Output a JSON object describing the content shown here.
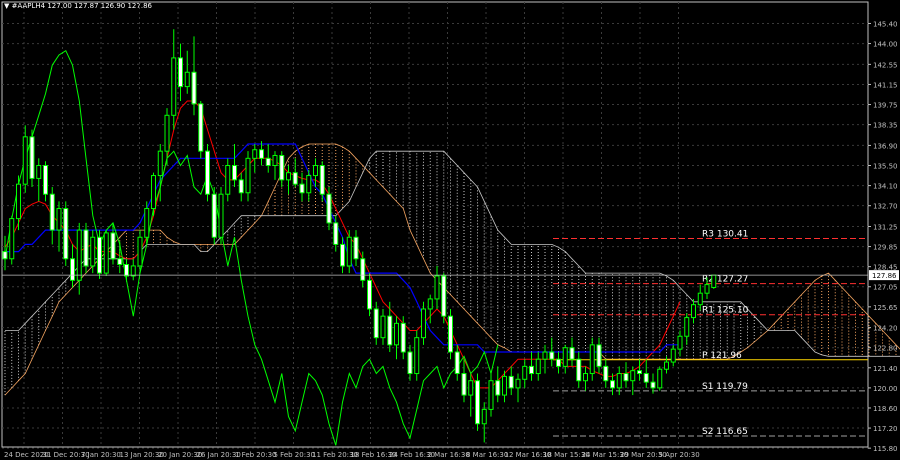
{
  "header": {
    "symbol_line": "#AAPLH4 127.00 127.87 126.90 127.86"
  },
  "colors": {
    "background": "#000000",
    "grid": "#3a3a3a",
    "axis": "#c0c0c0",
    "bull_candle": "#00ff00",
    "bull_body": "#000000",
    "bear_candle": "#00ff00",
    "bear_body": "#ffffff",
    "tenkan": "#ff0000",
    "kijun": "#0000ff",
    "chikou": "#00ff00",
    "kumo_bull": "#f4a460",
    "kumo_bear": "#c8c8c8",
    "pivot_main": "#ffd700",
    "pivot_res": "#ff3030",
    "pivot_sup": "#a0a0a0",
    "price_line": "#c0c0c0"
  },
  "chart_data": {
    "type": "candlestick",
    "grid": true,
    "y_range": [
      115.88,
      146.2
    ],
    "y_ticks": [
      "145.40",
      "144.00",
      "142.55",
      "141.15",
      "139.75",
      "138.35",
      "136.90",
      "135.50",
      "134.10",
      "132.70",
      "131.25",
      "129.85",
      "128.45",
      "127.05",
      "125.65",
      "124.20",
      "122.80",
      "121.40",
      "120.00",
      "118.60",
      "117.20",
      "115.80"
    ],
    "x_labels": [
      "24 Dec 2020",
      "31 Dec 20:30",
      "7 Jan 20:30",
      "13 Jan 20:30",
      "20 Jan 20:30",
      "26 Jan 20:30",
      "1 Feb 20:30",
      "5 Feb 20:30",
      "11 Feb 20:30",
      "18 Feb 16:30",
      "24 Feb 16:30",
      "2 Mar 16:30",
      "8 Mar 16:30",
      "12 Mar 16:30",
      "18 Mar 15:30",
      "24 Mar 15:30",
      "29 Mar 20:30",
      "5 Apr 20:30"
    ],
    "current_price": "127.86",
    "candles": [
      {
        "o": 129.5,
        "h": 130.6,
        "l": 128.2,
        "c": 129.0
      },
      {
        "o": 129.0,
        "h": 132.0,
        "l": 128.6,
        "c": 131.8
      },
      {
        "o": 131.8,
        "h": 134.8,
        "l": 131.0,
        "c": 134.2
      },
      {
        "o": 134.2,
        "h": 138.3,
        "l": 133.6,
        "c": 137.5
      },
      {
        "o": 137.5,
        "h": 138.0,
        "l": 134.0,
        "c": 134.6
      },
      {
        "o": 134.6,
        "h": 136.0,
        "l": 133.0,
        "c": 135.5
      },
      {
        "o": 135.5,
        "h": 135.8,
        "l": 133.0,
        "c": 133.5
      },
      {
        "o": 133.5,
        "h": 134.0,
        "l": 130.0,
        "c": 131.0
      },
      {
        "o": 131.0,
        "h": 133.0,
        "l": 129.5,
        "c": 132.5
      },
      {
        "o": 132.5,
        "h": 133.0,
        "l": 128.5,
        "c": 129.0
      },
      {
        "o": 129.0,
        "h": 130.0,
        "l": 127.0,
        "c": 127.5
      },
      {
        "o": 127.5,
        "h": 131.5,
        "l": 126.5,
        "c": 131.0
      },
      {
        "o": 131.0,
        "h": 131.5,
        "l": 128.0,
        "c": 128.5
      },
      {
        "o": 128.5,
        "h": 131.0,
        "l": 128.0,
        "c": 130.5
      },
      {
        "o": 130.5,
        "h": 131.0,
        "l": 127.6,
        "c": 128.0
      },
      {
        "o": 128.0,
        "h": 131.0,
        "l": 127.8,
        "c": 130.8
      },
      {
        "o": 130.8,
        "h": 131.5,
        "l": 128.6,
        "c": 129.0
      },
      {
        "o": 129.0,
        "h": 130.2,
        "l": 128.0,
        "c": 128.6
      },
      {
        "o": 128.6,
        "h": 129.0,
        "l": 127.4,
        "c": 127.8
      },
      {
        "o": 127.8,
        "h": 129.0,
        "l": 127.5,
        "c": 128.5
      },
      {
        "o": 128.5,
        "h": 131.0,
        "l": 128.0,
        "c": 130.5
      },
      {
        "o": 130.5,
        "h": 133.0,
        "l": 130.0,
        "c": 132.5
      },
      {
        "o": 132.5,
        "h": 135.0,
        "l": 132.0,
        "c": 134.8
      },
      {
        "o": 134.8,
        "h": 137.0,
        "l": 133.0,
        "c": 136.5
      },
      {
        "o": 136.5,
        "h": 139.5,
        "l": 135.5,
        "c": 139.0
      },
      {
        "o": 139.0,
        "h": 145.0,
        "l": 138.0,
        "c": 143.0
      },
      {
        "o": 143.0,
        "h": 144.0,
        "l": 140.0,
        "c": 141.0
      },
      {
        "o": 141.0,
        "h": 143.5,
        "l": 140.5,
        "c": 142.0
      },
      {
        "o": 142.0,
        "h": 144.5,
        "l": 139.0,
        "c": 139.8
      },
      {
        "o": 139.8,
        "h": 140.0,
        "l": 136.0,
        "c": 136.5
      },
      {
        "o": 136.5,
        "h": 137.0,
        "l": 133.0,
        "c": 133.5
      },
      {
        "o": 133.5,
        "h": 134.0,
        "l": 130.0,
        "c": 130.5
      },
      {
        "o": 130.5,
        "h": 134.0,
        "l": 130.0,
        "c": 133.5
      },
      {
        "o": 133.5,
        "h": 136.0,
        "l": 133.0,
        "c": 135.5
      },
      {
        "o": 135.5,
        "h": 137.0,
        "l": 134.0,
        "c": 134.5
      },
      {
        "o": 134.5,
        "h": 135.0,
        "l": 133.0,
        "c": 133.6
      },
      {
        "o": 133.6,
        "h": 136.5,
        "l": 133.0,
        "c": 136.0
      },
      {
        "o": 136.0,
        "h": 137.0,
        "l": 135.0,
        "c": 136.6
      },
      {
        "o": 136.6,
        "h": 137.2,
        "l": 135.5,
        "c": 136.0
      },
      {
        "o": 136.0,
        "h": 137.0,
        "l": 135.0,
        "c": 135.5
      },
      {
        "o": 135.5,
        "h": 136.5,
        "l": 134.5,
        "c": 136.2
      },
      {
        "o": 136.2,
        "h": 136.5,
        "l": 134.0,
        "c": 134.5
      },
      {
        "o": 134.5,
        "h": 135.5,
        "l": 133.5,
        "c": 135.0
      },
      {
        "o": 135.0,
        "h": 136.0,
        "l": 134.0,
        "c": 134.2
      },
      {
        "o": 134.2,
        "h": 135.0,
        "l": 133.0,
        "c": 133.6
      },
      {
        "o": 133.6,
        "h": 135.2,
        "l": 133.0,
        "c": 134.8
      },
      {
        "o": 134.8,
        "h": 136.0,
        "l": 134.0,
        "c": 135.5
      },
      {
        "o": 135.5,
        "h": 135.8,
        "l": 133.0,
        "c": 133.5
      },
      {
        "o": 133.5,
        "h": 134.0,
        "l": 131.0,
        "c": 131.5
      },
      {
        "o": 131.5,
        "h": 132.0,
        "l": 129.5,
        "c": 130.0
      },
      {
        "o": 130.0,
        "h": 130.5,
        "l": 128.0,
        "c": 128.5
      },
      {
        "o": 128.5,
        "h": 131.0,
        "l": 128.0,
        "c": 130.5
      },
      {
        "o": 130.5,
        "h": 131.0,
        "l": 128.5,
        "c": 129.0
      },
      {
        "o": 129.0,
        "h": 129.5,
        "l": 127.0,
        "c": 127.5
      },
      {
        "o": 127.5,
        "h": 128.0,
        "l": 125.0,
        "c": 125.5
      },
      {
        "o": 125.5,
        "h": 126.0,
        "l": 123.0,
        "c": 123.5
      },
      {
        "o": 123.5,
        "h": 125.5,
        "l": 123.0,
        "c": 125.0
      },
      {
        "o": 125.0,
        "h": 126.0,
        "l": 122.5,
        "c": 123.0
      },
      {
        "o": 123.0,
        "h": 125.0,
        "l": 122.0,
        "c": 124.5
      },
      {
        "o": 124.5,
        "h": 125.0,
        "l": 122.0,
        "c": 122.5
      },
      {
        "o": 122.5,
        "h": 123.0,
        "l": 120.5,
        "c": 121.0
      },
      {
        "o": 121.0,
        "h": 124.0,
        "l": 120.5,
        "c": 123.5
      },
      {
        "o": 123.5,
        "h": 126.0,
        "l": 123.0,
        "c": 125.5
      },
      {
        "o": 125.5,
        "h": 126.5,
        "l": 124.5,
        "c": 126.2
      },
      {
        "o": 126.2,
        "h": 128.5,
        "l": 125.5,
        "c": 127.8
      },
      {
        "o": 127.8,
        "h": 128.0,
        "l": 124.5,
        "c": 125.0
      },
      {
        "o": 125.0,
        "h": 125.5,
        "l": 122.0,
        "c": 122.5
      },
      {
        "o": 122.5,
        "h": 123.0,
        "l": 120.5,
        "c": 121.0
      },
      {
        "o": 121.0,
        "h": 122.0,
        "l": 119.0,
        "c": 119.5
      },
      {
        "o": 119.5,
        "h": 121.0,
        "l": 118.0,
        "c": 120.5
      },
      {
        "o": 120.5,
        "h": 121.0,
        "l": 117.0,
        "c": 117.5
      },
      {
        "o": 117.5,
        "h": 119.0,
        "l": 116.2,
        "c": 118.5
      },
      {
        "o": 118.5,
        "h": 121.0,
        "l": 118.0,
        "c": 120.5
      },
      {
        "o": 120.5,
        "h": 121.5,
        "l": 119.0,
        "c": 119.5
      },
      {
        "o": 119.5,
        "h": 121.2,
        "l": 119.0,
        "c": 120.8
      },
      {
        "o": 120.8,
        "h": 121.5,
        "l": 119.5,
        "c": 120.0
      },
      {
        "o": 120.0,
        "h": 121.0,
        "l": 119.0,
        "c": 120.6
      },
      {
        "o": 120.6,
        "h": 122.0,
        "l": 120.0,
        "c": 121.5
      },
      {
        "o": 121.5,
        "h": 122.5,
        "l": 120.5,
        "c": 121.0
      },
      {
        "o": 121.0,
        "h": 122.5,
        "l": 120.5,
        "c": 122.0
      },
      {
        "o": 122.0,
        "h": 123.0,
        "l": 121.0,
        "c": 122.5
      },
      {
        "o": 122.5,
        "h": 123.5,
        "l": 121.5,
        "c": 122.0
      },
      {
        "o": 122.0,
        "h": 122.5,
        "l": 121.0,
        "c": 121.5
      },
      {
        "o": 121.5,
        "h": 123.0,
        "l": 121.0,
        "c": 122.8
      },
      {
        "o": 122.8,
        "h": 123.5,
        "l": 121.5,
        "c": 122.0
      },
      {
        "o": 122.0,
        "h": 122.5,
        "l": 120.0,
        "c": 120.5
      },
      {
        "o": 120.5,
        "h": 121.5,
        "l": 119.8,
        "c": 121.0
      },
      {
        "o": 121.0,
        "h": 123.5,
        "l": 120.5,
        "c": 123.0
      },
      {
        "o": 123.0,
        "h": 123.5,
        "l": 121.0,
        "c": 121.5
      },
      {
        "o": 121.5,
        "h": 122.0,
        "l": 120.0,
        "c": 120.5
      },
      {
        "o": 120.5,
        "h": 121.0,
        "l": 119.5,
        "c": 120.0
      },
      {
        "o": 120.0,
        "h": 121.5,
        "l": 119.5,
        "c": 121.0
      },
      {
        "o": 121.0,
        "h": 121.8,
        "l": 120.0,
        "c": 120.5
      },
      {
        "o": 120.5,
        "h": 121.5,
        "l": 119.5,
        "c": 121.2
      },
      {
        "o": 121.2,
        "h": 122.0,
        "l": 120.5,
        "c": 121.0
      },
      {
        "o": 121.0,
        "h": 122.0,
        "l": 120.0,
        "c": 120.4
      },
      {
        "o": 120.4,
        "h": 121.0,
        "l": 119.6,
        "c": 120.0
      },
      {
        "o": 120.0,
        "h": 121.5,
        "l": 119.8,
        "c": 121.3
      },
      {
        "o": 121.3,
        "h": 122.2,
        "l": 121.0,
        "c": 121.8
      },
      {
        "o": 121.8,
        "h": 123.0,
        "l": 121.5,
        "c": 122.7
      },
      {
        "o": 122.7,
        "h": 124.0,
        "l": 122.2,
        "c": 123.6
      },
      {
        "o": 123.6,
        "h": 125.2,
        "l": 123.0,
        "c": 124.9
      },
      {
        "o": 124.9,
        "h": 126.2,
        "l": 124.5,
        "c": 125.8
      },
      {
        "o": 125.8,
        "h": 127.2,
        "l": 125.4,
        "c": 126.6
      },
      {
        "o": 126.6,
        "h": 127.7,
        "l": 126.2,
        "c": 127.2
      },
      {
        "o": 127.0,
        "h": 127.87,
        "l": 126.9,
        "c": 127.86
      }
    ],
    "tenkan": [
      129.8,
      130.5,
      131.5,
      132.5,
      132.8,
      133.0,
      132.8,
      132.0,
      131.5,
      131.0,
      130.0,
      129.5,
      129.8,
      130.0,
      129.5,
      129.5,
      129.5,
      129.2,
      129.0,
      129.0,
      129.5,
      130.5,
      132.0,
      134.0,
      136.0,
      138.0,
      139.5,
      140.0,
      140.0,
      139.5,
      138.0,
      136.5,
      135.0,
      134.5,
      134.5,
      135.0,
      135.5,
      136.0,
      136.0,
      136.0,
      135.8,
      135.5,
      135.0,
      134.8,
      134.6,
      134.5,
      134.5,
      134.2,
      133.5,
      132.5,
      131.5,
      130.5,
      130.0,
      129.0,
      128.0,
      127.0,
      126.0,
      125.5,
      125.0,
      124.5,
      124.0,
      124.0,
      124.5,
      125.0,
      125.5,
      125.0,
      124.0,
      123.0,
      122.0,
      121.0,
      120.0,
      120.0,
      120.0,
      120.5,
      121.0,
      121.5,
      122.0,
      122.0,
      122.0,
      122.0,
      122.0,
      122.0,
      122.0,
      121.5,
      121.5,
      121.5,
      121.5,
      121.2,
      121.0,
      120.8,
      120.8,
      121.0,
      121.0,
      121.2,
      121.5,
      122.0,
      122.5,
      123.0,
      124.0,
      125.0,
      126.0
    ],
    "kijun": [
      129.5,
      129.5,
      129.5,
      130.0,
      130.0,
      130.5,
      131.0,
      131.0,
      131.0,
      131.0,
      131.0,
      131.0,
      131.0,
      131.0,
      131.0,
      131.0,
      131.0,
      131.0,
      131.0,
      131.0,
      131.5,
      132.5,
      133.5,
      134.5,
      135.0,
      135.5,
      136.0,
      136.0,
      136.0,
      136.0,
      136.0,
      136.0,
      136.0,
      136.0,
      136.0,
      136.5,
      137.0,
      137.0,
      137.0,
      137.0,
      137.0,
      137.0,
      137.0,
      137.0,
      136.0,
      135.0,
      134.0,
      133.5,
      132.5,
      131.5,
      130.5,
      129.0,
      128.0,
      128.0,
      128.0,
      128.0,
      128.0,
      128.0,
      128.0,
      127.5,
      127.0,
      126.0,
      125.0,
      124.0,
      123.5,
      123.0,
      123.0,
      123.0,
      123.0,
      123.0,
      123.0,
      122.5,
      122.5,
      122.5,
      122.5,
      122.5,
      122.5,
      122.5,
      122.5,
      122.5,
      122.5,
      122.5,
      122.5,
      122.5,
      122.5,
      122.5,
      122.5,
      122.5,
      122.5,
      122.5,
      122.5,
      122.5,
      122.5,
      122.5,
      122.5,
      122.5,
      122.5,
      122.5,
      123.0,
      123.0,
      123.0
    ],
    "chikou": [
      129.0,
      131.8,
      134.2,
      136.0,
      137.5,
      139.0,
      140.5,
      142.5,
      143.2,
      143.5,
      142.5,
      140.0,
      136.0,
      132.0,
      130.0,
      131.0,
      131.5,
      130.0,
      127.5,
      125.0,
      128.0,
      130.0,
      132.5,
      134.0,
      136.0,
      136.5,
      135.5,
      136.2,
      134.0,
      133.5,
      134.8,
      133.5,
      131.0,
      128.5,
      130.5,
      127.5,
      125.0,
      123.0,
      122.0,
      120.5,
      119.0,
      121.0,
      118.0,
      117.0,
      119.0,
      121.0,
      120.5,
      119.5,
      117.5,
      116.0,
      119.0,
      121.0,
      120.0,
      121.5,
      122.0,
      121.0,
      121.5,
      120.0,
      119.0,
      117.5,
      116.5,
      118.5,
      120.5,
      121.0,
      121.5,
      120.0,
      121.0,
      121.5,
      122.2,
      121.0,
      121.5,
      122.5,
      121.0,
      123.0
    ],
    "span_a": [
      119.5,
      120.0,
      120.5,
      121.0,
      122.0,
      123.0,
      124.0,
      125.0,
      126.0,
      126.5,
      127.0,
      127.5,
      128.0,
      128.5,
      129.0,
      129.5,
      130.0,
      130.5,
      131.0,
      131.0,
      131.0,
      131.0,
      131.0,
      131.0,
      130.5,
      130.2,
      130.0,
      130.0,
      130.0,
      130.0,
      130.0,
      130.0,
      130.0,
      130.0,
      130.0,
      130.5,
      131.0,
      131.5,
      132.0,
      133.0,
      134.0,
      135.0,
      136.0,
      136.5,
      136.8,
      137.0,
      137.0,
      137.0,
      137.0,
      137.0,
      136.8,
      136.5,
      136.0,
      135.5,
      135.0,
      134.5,
      134.0,
      133.5,
      133.0,
      132.5,
      131.0,
      130.0,
      129.0,
      128.0,
      127.5,
      127.0,
      126.5,
      126.0,
      125.5,
      125.0,
      124.5,
      124.0,
      123.5,
      123.0,
      122.8,
      122.5,
      122.5,
      122.5,
      122.5,
      122.5,
      122.5,
      122.5,
      122.5,
      122.5,
      122.5,
      122.5,
      122.5,
      122.5,
      122.5,
      122.0,
      122.0,
      122.0,
      122.0,
      122.0,
      122.0,
      122.0,
      122.0,
      122.0,
      122.0,
      122.0,
      122.0,
      122.0,
      122.0,
      122.0,
      122.0,
      122.0,
      122.0,
      122.0,
      122.2,
      122.5,
      122.8,
      123.2,
      123.6,
      124.0,
      124.5,
      125.0,
      125.5,
      126.0,
      126.5,
      127.0,
      127.5,
      127.8,
      128.0,
      127.5,
      127.0,
      126.5,
      126.0,
      125.5,
      125.0,
      124.5,
      124.0,
      123.5,
      123.0,
      122.5
    ],
    "span_b": [
      124.0,
      124.0,
      124.0,
      124.5,
      125.0,
      125.5,
      126.0,
      126.5,
      127.0,
      127.5,
      128.0,
      128.5,
      129.0,
      129.0,
      129.0,
      129.0,
      129.0,
      129.0,
      129.0,
      129.0,
      129.5,
      130.0,
      130.0,
      130.0,
      130.0,
      130.0,
      130.0,
      130.0,
      130.0,
      129.5,
      129.5,
      130.0,
      130.5,
      131.0,
      131.5,
      132.0,
      132.0,
      132.0,
      132.0,
      132.0,
      132.0,
      132.0,
      132.0,
      132.0,
      132.0,
      132.0,
      132.0,
      132.0,
      132.0,
      132.0,
      132.5,
      133.0,
      134.0,
      135.0,
      136.0,
      136.5,
      136.5,
      136.5,
      136.5,
      136.5,
      136.5,
      136.5,
      136.5,
      136.5,
      136.5,
      136.5,
      136.0,
      135.5,
      135.0,
      134.5,
      134.0,
      133.0,
      132.0,
      131.0,
      130.5,
      130.0,
      130.0,
      130.0,
      130.0,
      130.0,
      130.0,
      130.0,
      129.8,
      129.5,
      129.0,
      128.5,
      128.0,
      128.0,
      128.0,
      128.0,
      128.0,
      128.0,
      128.0,
      128.0,
      128.0,
      128.0,
      128.0,
      128.0,
      127.8,
      127.5,
      127.0,
      126.5,
      126.0,
      126.0,
      126.0,
      126.0,
      126.0,
      126.0,
      126.0,
      126.0,
      125.5,
      125.0,
      124.5,
      124.0,
      124.0,
      124.0,
      124.0,
      124.0,
      123.5,
      123.0,
      122.5,
      122.3,
      122.2,
      122.2,
      122.2,
      122.2,
      122.2,
      122.2,
      122.2,
      122.2,
      122.2,
      122.2,
      122.2,
      122.2,
      122.2,
      122.2
    ]
  },
  "pivots": [
    {
      "label": "R3",
      "value": "130.41",
      "v": 130.41,
      "kind": "res"
    },
    {
      "label": "R2",
      "value": "127.27",
      "v": 127.27,
      "kind": "res"
    },
    {
      "label": "R1",
      "value": "125.10",
      "v": 125.1,
      "kind": "res"
    },
    {
      "label": "P",
      "value": "121.96",
      "v": 121.96,
      "kind": "main"
    },
    {
      "label": "S1",
      "value": "119.79",
      "v": 119.79,
      "kind": "sup"
    },
    {
      "label": "S2",
      "value": "116.65",
      "v": 116.65,
      "kind": "sup"
    }
  ]
}
